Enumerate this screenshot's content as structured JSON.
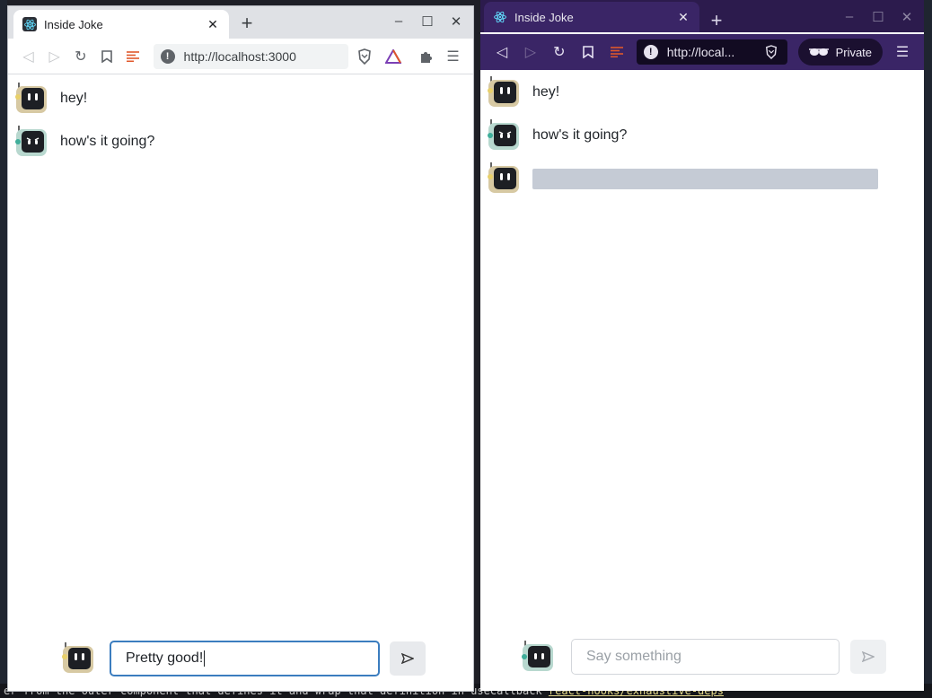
{
  "left_browser": {
    "tab_title": "Inside Joke",
    "url": "http://localhost:3000",
    "messages": [
      {
        "text": "hey!"
      },
      {
        "text": "how's it going?"
      }
    ],
    "composer": {
      "value": "Pretty good!"
    }
  },
  "right_browser": {
    "tab_title": "Inside Joke",
    "url": "http://local...",
    "private_label": "Private",
    "messages": [
      {
        "text": "hey!"
      },
      {
        "text": "how's it going?"
      }
    ],
    "composer": {
      "placeholder": "Say something"
    }
  },
  "desktop": {
    "terminal_line": "er from the outer component that defines it and wrap that definition in useCallback",
    "terminal_rule": "react-hooks/exhaustive-deps"
  },
  "colors": {
    "avatar_frame": "#d7c9a3",
    "avatar_teal": "#3fae9a",
    "skeleton": "#c5cbd5",
    "private_window": "#2c1b4d"
  }
}
